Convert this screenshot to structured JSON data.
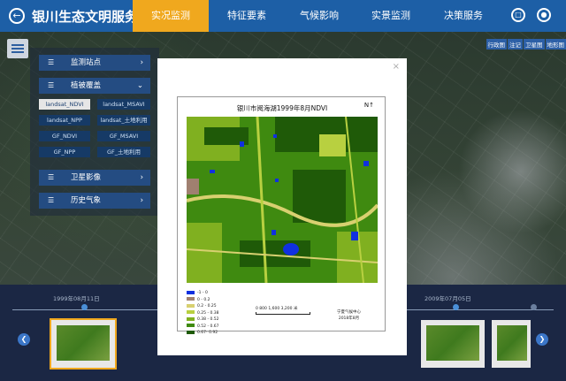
{
  "header": {
    "app_title": "银川生态文明服务平",
    "back_icon": "back-icon",
    "tabs": [
      {
        "label": "实况监测",
        "active": true
      },
      {
        "label": "特征要素",
        "active": false
      },
      {
        "label": "气候影响",
        "active": false
      },
      {
        "label": "实景监测",
        "active": false
      },
      {
        "label": "决策服务",
        "active": false
      }
    ],
    "right_icons": [
      "document-icon",
      "user-icon"
    ],
    "active_color": "#f0a81e",
    "bar_color": "#1d5fa6"
  },
  "map": {
    "layer_switch": [
      "行政图",
      "注记",
      "卫星图",
      "地形图"
    ]
  },
  "side_panel": {
    "sections": [
      {
        "label": "监测站点"
      },
      {
        "label": "植被覆盖"
      },
      {
        "label": "卫星影像"
      },
      {
        "label": "历史气象"
      }
    ],
    "sub_items": [
      {
        "label": "landsat_NDVI",
        "active": true
      },
      {
        "label": "landsat_MSAVI",
        "active": false
      },
      {
        "label": "landsat_NPP",
        "active": false
      },
      {
        "label": "landsat_土地利用",
        "active": false
      },
      {
        "label": "GF_NDVI",
        "active": false
      },
      {
        "label": "GF_MSAVI",
        "active": false
      },
      {
        "label": "GF_NPP",
        "active": false
      },
      {
        "label": "GF_土地利用",
        "active": false
      }
    ]
  },
  "timeline": {
    "start_date": "1999年08月11日",
    "end_date": "2009年07月05日"
  },
  "modal": {
    "close_label": "×",
    "figure": {
      "title": "银川市阅海湖1999年8月NDVI",
      "north_label": "N",
      "legend": [
        {
          "label": "-1 - 0",
          "color": "#1030e0"
        },
        {
          "label": "0 - 0.2",
          "color": "#a08070"
        },
        {
          "label": "0.2 - 0.25",
          "color": "#d8d070"
        },
        {
          "label": "0.25 - 0.38",
          "color": "#b8d040"
        },
        {
          "label": "0.38 - 0.52",
          "color": "#80b020"
        },
        {
          "label": "0.52 - 0.67",
          "color": "#3f8a10"
        },
        {
          "label": "0.67- 0.92",
          "color": "#1f5a08"
        }
      ],
      "scale_label": "0   800 1,600        3,200 米",
      "credit_org": "宁夏气候中心",
      "credit_date": "2018年8月"
    }
  }
}
